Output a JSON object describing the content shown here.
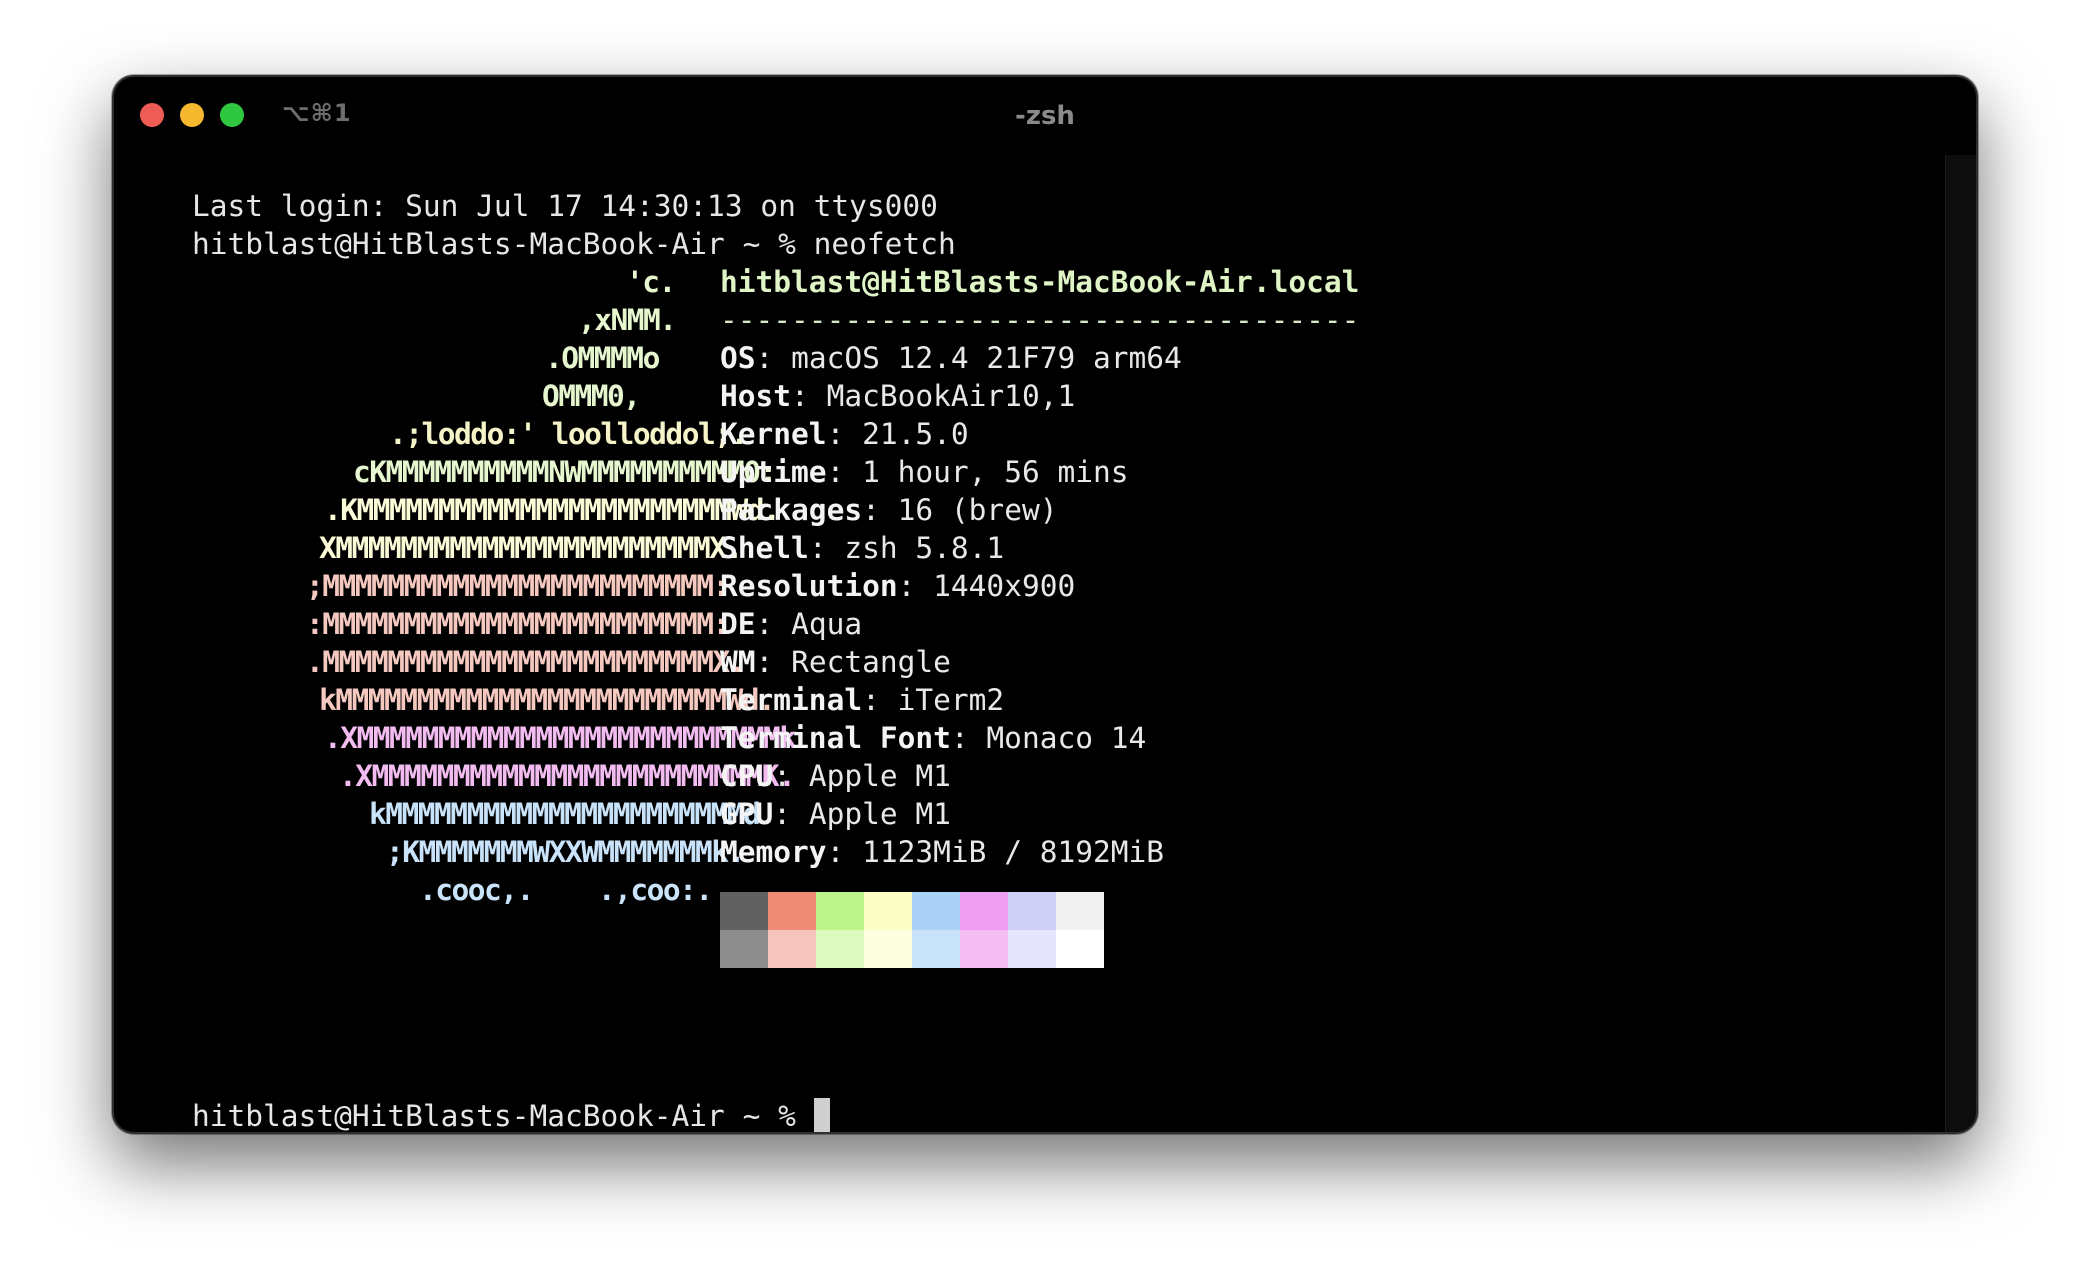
{
  "window": {
    "title": "-zsh",
    "shortcut": "⌥⌘1",
    "traffic_colors": {
      "close": "#ee5c55",
      "minimize": "#f5b82e",
      "zoom": "#2fc640"
    }
  },
  "terminal": {
    "last_login": "Last login: Sun Jul 17 14:30:13 on ttys000",
    "prompt_command": "hitblast@HitBlasts-MacBook-Air ~ % neofetch",
    "final_prompt": "hitblast@HitBlasts-MacBook-Air ~ % "
  },
  "logo": [
    {
      "text": "'c.",
      "color": "#e6f7cf"
    },
    {
      "text": ",xNMM.",
      "color": "#e6f7cf"
    },
    {
      "text": ".OMMMMo",
      "color": "#e6f7cf"
    },
    {
      "text": "OMMM0,",
      "color": "#e6f7cf"
    },
    {
      "text": ".;loddo:' loolloddol;.",
      "color": "#f4f4c8"
    },
    {
      "text": "cKMMMMMMMMMMNWMMMMMMMMMM0:",
      "color": "#e6f7cf"
    },
    {
      "text": ".KMMMMMMMMMMMMMMMMMMMMMMMWd.",
      "color": "#fbfbd8"
    },
    {
      "text": "XMMMMMMMMMMMMMMMMMMMMMMMX.",
      "color": "#fbfbd8"
    },
    {
      "text": ";MMMMMMMMMMMMMMMMMMMMMMMM:",
      "color": "#f6c9c0"
    },
    {
      "text": ":MMMMMMMMMMMMMMMMMMMMMMMM:",
      "color": "#f6c9c0"
    },
    {
      "text": ".MMMMMMMMMMMMMMMMMMMMMMMMX.",
      "color": "#f6c9c0"
    },
    {
      "text": "kMMMMMMMMMMMMMMMMMMMMMMMMWd.",
      "color": "#f6c9c0"
    },
    {
      "text": ".XMMMMMMMMMMMMMMMMMMMMMMMMMMk",
      "color": "#f3bcf0"
    },
    {
      "text": ".XMMMMMMMMMMMMMMMMMMMMMMMMK.",
      "color": "#f3bcf0"
    },
    {
      "text": "kMMMMMMMMMMMMMMMMMMMMMMd",
      "color": "#c9e3fb"
    },
    {
      "text": ";KMMMMMMMWXXWMMMMMMMk.",
      "color": "#c9e3fb"
    },
    {
      "text": ".cooc,.    .,coo:.",
      "color": "#c9e3fb"
    }
  ],
  "info": {
    "userhost": "hitblast@HitBlasts-MacBook-Air.local",
    "separator": "------------------------------------",
    "fields": [
      {
        "key": "OS",
        "value": "macOS 12.4 21F79 arm64"
      },
      {
        "key": "Host",
        "value": "MacBookAir10,1"
      },
      {
        "key": "Kernel",
        "value": "21.5.0"
      },
      {
        "key": "Uptime",
        "value": "1 hour, 56 mins"
      },
      {
        "key": "Packages",
        "value": "16 (brew)"
      },
      {
        "key": "Shell",
        "value": "zsh 5.8.1"
      },
      {
        "key": "Resolution",
        "value": "1440x900"
      },
      {
        "key": "DE",
        "value": "Aqua"
      },
      {
        "key": "WM",
        "value": "Rectangle"
      },
      {
        "key": "Terminal",
        "value": "iTerm2"
      },
      {
        "key": "Terminal Font",
        "value": "Monaco 14"
      },
      {
        "key": "CPU",
        "value": "Apple M1"
      },
      {
        "key": "GPU",
        "value": "Apple M1"
      },
      {
        "key": "Memory",
        "value": "1123MiB / 8192MiB"
      }
    ]
  },
  "palette": {
    "normal": [
      "#616161",
      "#ee8b77",
      "#bdf58a",
      "#fdfdc6",
      "#abd1f7",
      "#ee9ef0",
      "#cfd0f8",
      "#f1f1f1"
    ],
    "bright": [
      "#8e8e8e",
      "#f5c4bd",
      "#dcf9bf",
      "#fdfde0",
      "#c8e2fa",
      "#f3bdf4",
      "#e5e5fb",
      "#ffffff"
    ]
  }
}
